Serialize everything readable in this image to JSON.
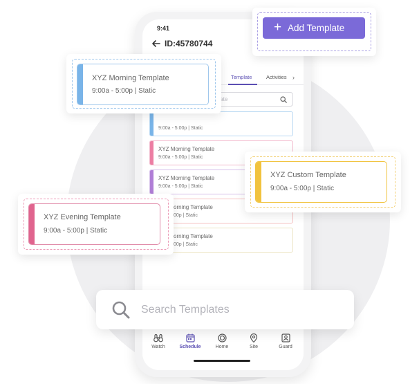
{
  "phone": {
    "status_time": "9:41",
    "header_title": "ID:45780744",
    "tabs": [
      {
        "label": "Template",
        "active": true
      },
      {
        "label": "Activities",
        "active": false
      }
    ],
    "search_placeholder_partial": "plate",
    "cards": [
      {
        "title": "",
        "subtitle": "9:00a - 5:00p | Static",
        "color": "#79b4e8"
      },
      {
        "title": "XYZ Morning Template",
        "subtitle": "9:00a - 5:00p | Static",
        "color": "#ec7ea3"
      },
      {
        "title": "XYZ Morning Template",
        "subtitle": "9:00a - 5:00p | Static",
        "color": "#b07ed6"
      },
      {
        "title": "orning Template",
        "subtitle": "00p | Static",
        "color": "#ee7a7a"
      },
      {
        "title": "orning Template",
        "subtitle": "00p | Static",
        "color": "#e5dcae"
      }
    ],
    "nav": [
      {
        "label": "Watch",
        "icon": "binoculars-icon"
      },
      {
        "label": "Schedule",
        "icon": "calendar-icon",
        "active": true
      },
      {
        "label": "Home",
        "icon": "home-icon"
      },
      {
        "label": "Site",
        "icon": "map-pin-icon"
      },
      {
        "label": "Guard",
        "icon": "guard-badge-icon"
      }
    ]
  },
  "add_template": {
    "label": "Add Template",
    "color": "#7b6ad8"
  },
  "callouts": {
    "morning": {
      "title": "XYZ Morning Template",
      "subtitle": "9:00a - 5:00p | Static",
      "color": "#79b4e8"
    },
    "custom": {
      "title": "XYZ Custom Template",
      "subtitle": "9:00a - 5:00p | Static",
      "color": "#f1c33e"
    },
    "evening": {
      "title": "XYZ Evening Template",
      "subtitle": "9:00a - 5:00p | Static",
      "color": "#e0648e"
    }
  },
  "search": {
    "placeholder": "Search Templates"
  }
}
